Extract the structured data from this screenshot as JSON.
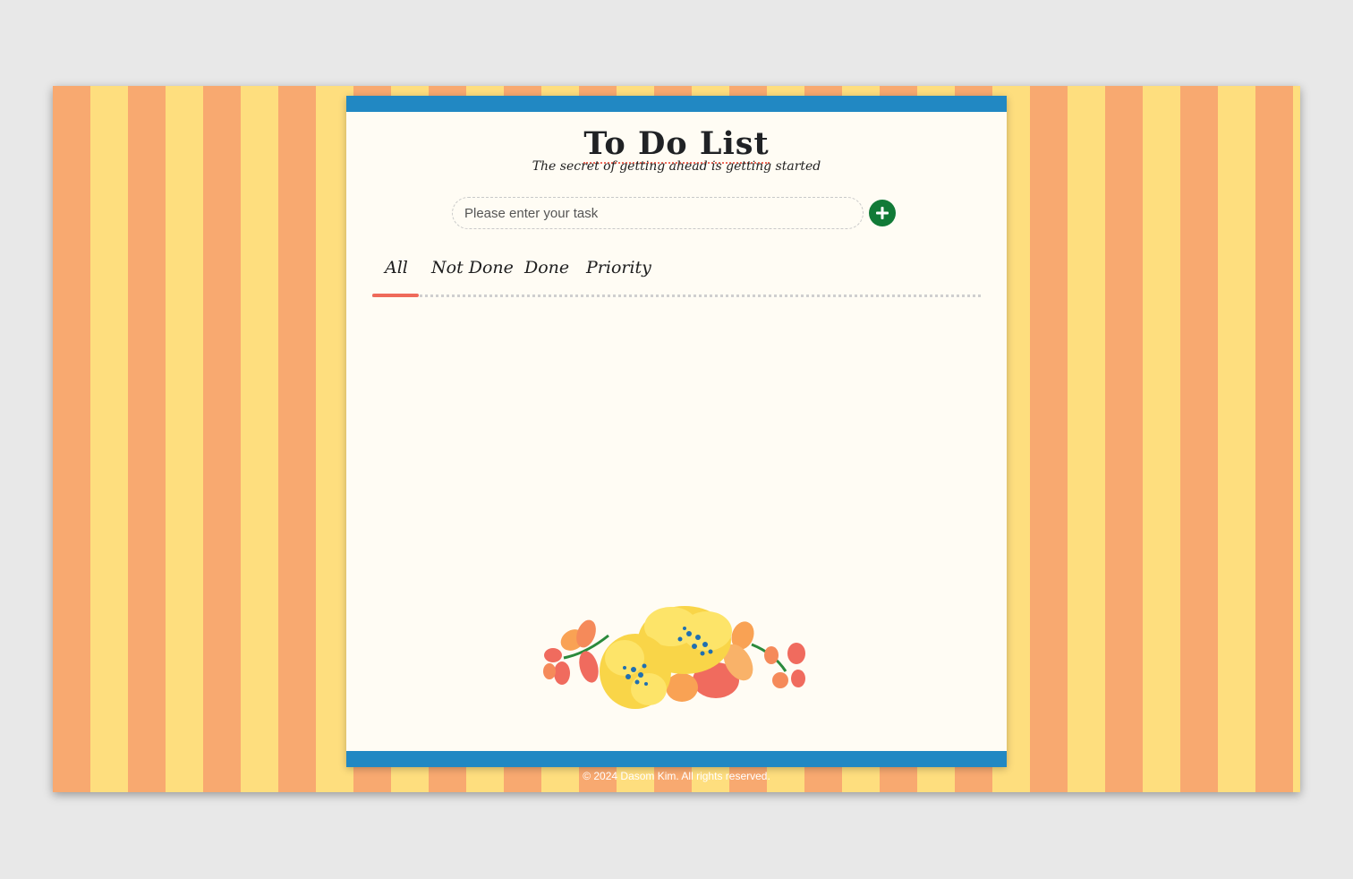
{
  "app": {
    "title": "To Do List",
    "subtitle": "The secret of getting ahead is getting started"
  },
  "input": {
    "placeholder": "Please enter your task",
    "value": ""
  },
  "add_button": {
    "icon": "plus-icon"
  },
  "tabs": [
    {
      "label": "All",
      "selected": true
    },
    {
      "label": "Not Done",
      "selected": false
    },
    {
      "label": "Done",
      "selected": false
    },
    {
      "label": "Priority",
      "selected": false
    }
  ],
  "tasks": [],
  "footer": {
    "text": "© 2024 Dasom Kim. All rights reserved."
  },
  "colors": {
    "stripe_orange": "#f8a970",
    "stripe_yellow": "#fede7e",
    "card_border": "#2188c3",
    "card_bg": "#fffcf4",
    "accent": "#ef6a5a",
    "add_button": "#117a37"
  }
}
